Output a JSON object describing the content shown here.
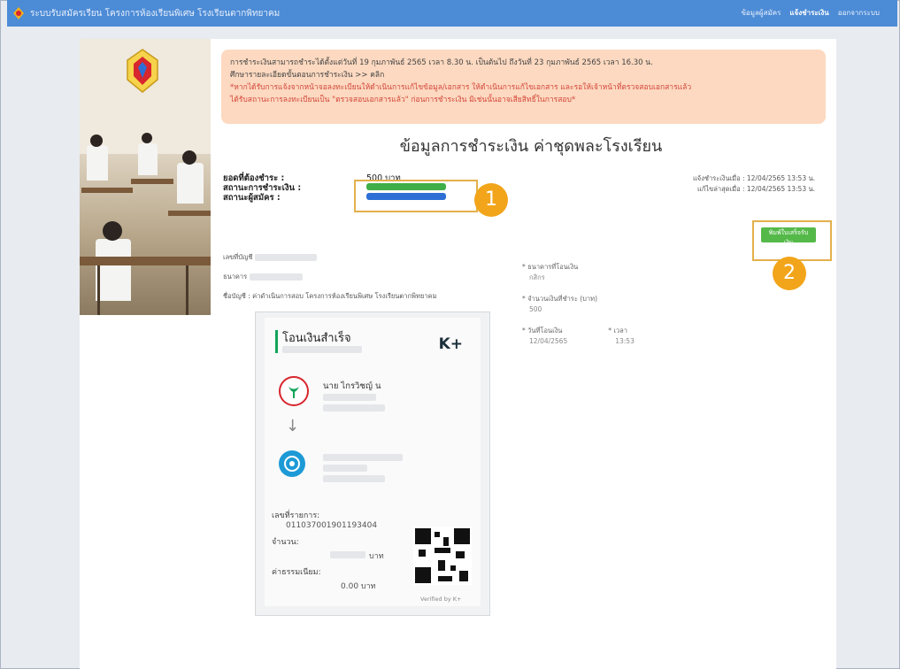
{
  "topbar": {
    "title": "ระบบรับสมัครเรียน โครงการห้องเรียนพิเศษ โรงเรียนตากพิทยาคม",
    "nav": [
      "ข้อมูลผู้สมัคร",
      "แจ้งชำระเงิน",
      "ออกจากระบบ"
    ],
    "active_index": 1
  },
  "notice": {
    "line1": "การชำระเงินสามารถชำระได้ตั้งแต่วันที่ 19 กุมภาพันธ์ 2565 เวลา 8.30 น. เป็นต้นไป ถึงวันที่ 23 กุมภาพันธ์ 2565 เวลา 16.30 น.",
    "line2": "ศึกษารายละเอียดขั้นตอนการชำระเงิน >> คลิก",
    "line3": "*หากได้รับการแจ้งจากหน้าจอลงทะเบียนให้ดำเนินการแก้ไขข้อมูล/เอกสาร ให้ดำเนินการแก้ไขเอกสาร และรอให้เจ้าหน้าที่ตรวจสอบเอกสารแล้ว",
    "line4": "ได้รับสถานะการลงทะเบียนเป็น \"ตรวจสอบเอกสารแล้ว\" ก่อนการชำระเงิน มิเช่นนั้นอาจเสียสิทธิ์ในการสอบ*"
  },
  "heading": "ข้อมูลการชำระเงิน ค่าชุดพละโรงเรียน",
  "info": {
    "amount_label": "ยอดที่ต้องชำระ :",
    "amount_value": "500 บาท",
    "pay_status_label": "สถานะการชำระเงิน :",
    "applicant_status_label": "สถานะผู้สมัคร :",
    "green_badge_color": "#3fae47",
    "blue_badge_color": "#2e6fd6"
  },
  "dates": {
    "notified": "แจ้งชำระเงินเมื่อ : 12/04/2565 13:53 น.",
    "updated": "แก้ไขล่าสุดเมื่อ : 12/04/2565 13:53 น."
  },
  "markers": [
    "1",
    "2"
  ],
  "print_button": "พิมพ์ใบเสร็จรับเงิน",
  "account": {
    "acct_no_label": "เลขที่บัญชี",
    "bank_label": "ธนาคาร",
    "name_line": "ชื่อบัญชี : ค่าดำเนินการสอบ โครงการห้องเรียนพิเศษ โรงเรียนตากพิทยาคม"
  },
  "form": {
    "bank_label": "* ธนาคารที่โอนเงิน",
    "bank_value": "กสิกร",
    "amount_label": "* จำนวนเงินที่ชำระ (บาท)",
    "amount_value": "500",
    "date_label": "* วันที่โอนเงิน",
    "date_value": "12/04/2565",
    "time_label": "* เวลา",
    "time_value": "13:53"
  },
  "slip": {
    "success": "โอนเงินสำเร็จ",
    "brand": "K+",
    "sender_name": "นาย ไกรวิชญ์ น",
    "ref_label": "เลขที่รายการ:",
    "ref_value": "011037001901193404",
    "amount_label": "จำนวน:",
    "amount_unit": "บาท",
    "fee_label": "ค่าธรรมเนียม:",
    "fee_value": "0.00 บาท",
    "verified": "Verified by K+"
  }
}
